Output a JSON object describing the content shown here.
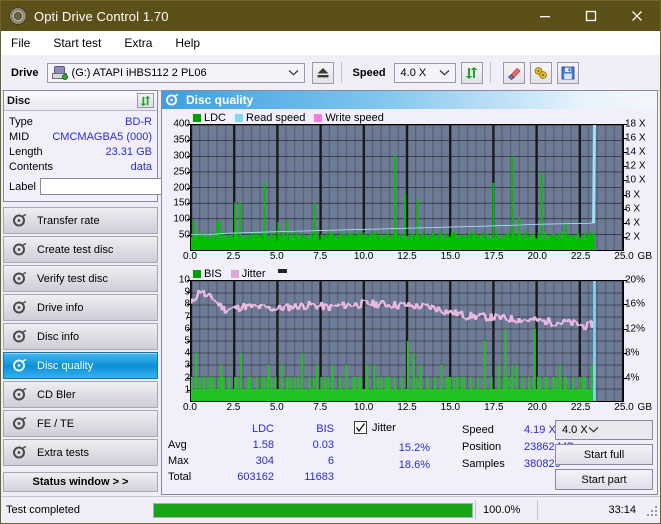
{
  "window": {
    "title": "Opti Drive Control 1.70",
    "minimize": "minimize",
    "maximize": "maximize",
    "close": "close",
    "titlebar_color": "#5b5118"
  },
  "menu": {
    "items": [
      "File",
      "Start test",
      "Extra",
      "Help"
    ]
  },
  "toolbar": {
    "drive_label": "Drive",
    "drive_value": "(G:)   ATAPI iHBS112  2 PL06",
    "eject": "eject",
    "speed_label": "Speed",
    "speed_value": "4.0 X",
    "refresh": "refresh",
    "erase": "erase",
    "tools": "tools",
    "save": "save"
  },
  "disc": {
    "title": "Disc",
    "refresh_btn": "refresh",
    "rows": [
      {
        "key": "Type",
        "value": "BD-R"
      },
      {
        "key": "MID",
        "value": "CMCMAGBA5 (000)"
      },
      {
        "key": "Length",
        "value": "23.31 GB"
      },
      {
        "key": "Contents",
        "value": "data"
      }
    ],
    "label_key": "Label",
    "label_value": "",
    "label_placeholder": ""
  },
  "nav": {
    "items": [
      {
        "label": "Transfer rate",
        "selected": false
      },
      {
        "label": "Create test disc",
        "selected": false
      },
      {
        "label": "Verify test disc",
        "selected": false
      },
      {
        "label": "Drive info",
        "selected": false
      },
      {
        "label": "Disc info",
        "selected": false
      },
      {
        "label": "Disc quality",
        "selected": true
      },
      {
        "label": "CD Bler",
        "selected": false
      },
      {
        "label": "FE / TE",
        "selected": false
      },
      {
        "label": "Extra tests",
        "selected": false
      }
    ],
    "status_window": "Status window > >"
  },
  "main": {
    "title": "Disc quality"
  },
  "stats": {
    "col_headers": [
      "LDC",
      "BIS"
    ],
    "row_headers": [
      "Avg",
      "Max",
      "Total"
    ],
    "ldc": [
      "1.58",
      "304",
      "603162"
    ],
    "bis": [
      "0.03",
      "6",
      "11683"
    ],
    "jitter_label": "Jitter",
    "jitter_checked": true,
    "jitter_avg": "15.2%",
    "jitter_max": "18.6%",
    "speed_key": "Speed",
    "speed_value": "4.19 X",
    "position_key": "Position",
    "position_value": "23862 MB",
    "samples_key": "Samples",
    "samples_value": "380829",
    "speed_select": "4.0 X",
    "start_full": "Start full",
    "start_part": "Start part"
  },
  "statusbar": {
    "message": "Test completed",
    "percent_label": "100.0%",
    "percent_value": 100,
    "elapsed": "33:14"
  },
  "colors": {
    "ldc_green": "#00b000",
    "read_speed": "#82d8f4",
    "write_speed": "#ff7adf",
    "bis_green": "#22c222",
    "jitter_pink": "#e8b8e0",
    "plot_bg": "#6e7b96",
    "progress_green": "#17a517"
  },
  "chart_data": [
    {
      "type": "line",
      "title": "LDC / Read speed",
      "xlabel": "GB",
      "ylabel": "LDC",
      "xlim": [
        0,
        25
      ],
      "ylim": [
        0,
        400
      ],
      "y2lim": [
        0,
        18
      ],
      "y2label": "X",
      "grid": true,
      "legend": [
        "LDC",
        "Read speed",
        "Write speed"
      ],
      "legend_position": "top-left",
      "xticks": [
        "0.0",
        "2.5",
        "5.0",
        "7.5",
        "10.0",
        "12.5",
        "15.0",
        "17.5",
        "20.0",
        "22.5",
        "25.0"
      ],
      "yticks": [
        50,
        100,
        150,
        200,
        250,
        300,
        350,
        400
      ],
      "y2ticks": [
        "2 X",
        "4 X",
        "6 X",
        "8 X",
        "10 X",
        "12 X",
        "14 X",
        "16 X",
        "18 X"
      ],
      "series": [
        {
          "name": "LDC",
          "kind": "impulse",
          "color": "#00b000",
          "x": [
            0.05,
            0.15,
            0.25,
            0.35,
            0.45,
            0.55,
            0.65,
            0.75,
            0.85,
            0.95,
            1.05,
            1.15,
            1.25,
            1.35,
            1.45,
            1.55,
            1.65,
            1.75,
            1.85,
            1.95,
            2.05,
            2.15,
            2.25,
            2.35,
            2.45,
            2.55,
            2.65,
            2.75,
            2.85,
            2.95,
            3.05,
            3.15,
            3.25,
            3.35,
            3.45,
            3.55,
            3.65,
            3.75,
            3.85,
            3.95,
            4.05,
            4.15,
            4.25,
            4.35,
            4.45,
            4.55,
            4.65,
            4.75,
            4.85,
            4.95,
            5.05,
            5.15,
            5.25,
            5.35,
            5.45,
            5.55,
            5.65,
            5.75,
            5.85,
            5.95,
            6.05,
            6.15,
            6.25,
            6.35,
            6.45,
            6.55,
            6.65,
            6.75,
            6.85,
            6.95,
            7.05,
            7.15,
            7.25,
            7.35,
            7.45,
            7.55,
            7.65,
            7.75,
            7.85,
            7.95,
            8.05,
            8.15,
            8.25,
            8.35,
            8.45,
            8.55,
            8.65,
            8.75,
            8.85,
            8.95,
            9.05,
            9.15,
            9.25,
            9.35,
            9.45,
            9.55,
            9.65,
            9.75,
            9.85,
            9.95,
            10.1,
            10.2,
            10.3,
            10.4,
            10.5,
            10.6,
            10.7,
            10.8,
            10.9,
            11.0,
            11.1,
            11.2,
            11.3,
            11.4,
            11.5,
            11.6,
            11.7,
            11.8,
            11.9,
            12.0,
            12.1,
            12.2,
            12.3,
            12.4,
            12.5,
            12.6,
            12.7,
            12.8,
            12.9,
            13.0,
            13.1,
            13.2,
            13.3,
            13.4,
            13.5,
            13.6,
            13.7,
            13.8,
            13.9,
            14.0,
            14.1,
            14.2,
            14.3,
            14.4,
            14.5,
            14.6,
            14.7,
            14.8,
            14.9,
            15.0,
            15.1,
            15.2,
            15.3,
            15.4,
            15.5,
            15.6,
            15.7,
            15.8,
            15.9,
            16.0,
            16.1,
            16.2,
            16.3,
            16.4,
            16.5,
            16.6,
            16.7,
            16.8,
            16.9,
            17.0,
            17.1,
            17.2,
            17.3,
            17.4,
            17.5,
            17.6,
            17.7,
            17.8,
            17.9,
            18.0,
            18.1,
            18.2,
            18.3,
            18.4,
            18.5,
            18.6,
            18.7,
            18.8,
            18.9,
            19.0,
            19.1,
            19.2,
            19.3,
            19.4,
            19.5,
            19.6,
            19.7,
            19.8,
            19.9,
            20.0,
            20.1,
            20.2,
            20.3,
            20.4,
            20.5,
            20.6,
            20.7,
            20.8,
            20.9,
            21.0,
            21.1,
            21.2,
            21.3,
            21.4,
            21.5,
            21.6,
            21.7,
            21.8,
            21.9,
            22.0,
            22.1,
            22.2,
            22.3,
            22.4,
            22.5,
            22.6,
            22.7,
            22.8,
            22.9,
            23.0,
            23.1,
            23.2,
            23.3
          ],
          "y": [
            42,
            95,
            40,
            55,
            35,
            60,
            30,
            45,
            38,
            50,
            42,
            35,
            48,
            30,
            55,
            88,
            95,
            40,
            62,
            35,
            50,
            38,
            45,
            30,
            42,
            152,
            60,
            38,
            152,
            45,
            35,
            50,
            42,
            30,
            38,
            55,
            45,
            60,
            35,
            50,
            40,
            30,
            215,
            55,
            42,
            35,
            60,
            38,
            48,
            30,
            90,
            45,
            35,
            52,
            40,
            95,
            30,
            42,
            55,
            38,
            45,
            60,
            35,
            50,
            40,
            30,
            48,
            42,
            35,
            55,
            38,
            152,
            60,
            42,
            30,
            50,
            35,
            45,
            40,
            38,
            62,
            55,
            35,
            48,
            42,
            30,
            60,
            38,
            50,
            35,
            45,
            40,
            55,
            30,
            42,
            48,
            35,
            60,
            38,
            50,
            45,
            35,
            42,
            55,
            30,
            60,
            38,
            48,
            35,
            50,
            42,
            40,
            30,
            55,
            38,
            45,
            35,
            305,
            60,
            42,
            30,
            50,
            38,
            180,
            45,
            35,
            40,
            55,
            30,
            48,
            165,
            42,
            35,
            60,
            38,
            50,
            45,
            30,
            42,
            55,
            40,
            35,
            48,
            60,
            38,
            30,
            50,
            45,
            35,
            42,
            55,
            38,
            60,
            30,
            48,
            40,
            35,
            50,
            42,
            38,
            55,
            30,
            45,
            60,
            35,
            42,
            48,
            38,
            50,
            30,
            55,
            40,
            35,
            45,
            215,
            38,
            60,
            42,
            30,
            50,
            35,
            48,
            55,
            40,
            38,
            300,
            62,
            30,
            45,
            105,
            50,
            35,
            42,
            60,
            38,
            48,
            30,
            55,
            40,
            35,
            50,
            42,
            245,
            38,
            60,
            30,
            45,
            48,
            35,
            52,
            40,
            38,
            55,
            30,
            60,
            42,
            90,
            35,
            50,
            45,
            38,
            48,
            30,
            55,
            40,
            35,
            42,
            60,
            38,
            50,
            45,
            30,
            55
          ]
        },
        {
          "name": "Read speed",
          "kind": "line",
          "color": "#82d8f4",
          "x": [
            0.0,
            1.0,
            2.0,
            3.2,
            4.5,
            6.0,
            7.5,
            9.0,
            10.5,
            12.0,
            13.5,
            15.0,
            16.5,
            17.8,
            19.0,
            20.0,
            21.0,
            22.0,
            23.0,
            23.3,
            23.35
          ],
          "y_speed_x": [
            2.2,
            2.2,
            2.4,
            2.5,
            2.6,
            2.7,
            2.8,
            2.9,
            3.0,
            3.1,
            3.2,
            3.3,
            3.4,
            3.5,
            3.6,
            3.7,
            3.75,
            3.8,
            3.85,
            3.9,
            18.0
          ]
        },
        {
          "name": "Write speed",
          "kind": "line",
          "color": "#ff7adf",
          "x": [],
          "y": []
        }
      ]
    },
    {
      "type": "line",
      "title": "BIS / Jitter",
      "xlabel": "GB",
      "ylabel": "BIS",
      "xlim": [
        0,
        25
      ],
      "ylim": [
        0,
        10
      ],
      "y2lim": [
        0,
        20
      ],
      "y2label": "%",
      "grid": true,
      "legend": [
        "BIS",
        "Jitter"
      ],
      "legend_position": "top-left",
      "xticks": [
        "0.0",
        "2.5",
        "5.0",
        "7.5",
        "10.0",
        "12.5",
        "15.0",
        "17.5",
        "20.0",
        "22.5",
        "25.0"
      ],
      "yticks": [
        1,
        2,
        3,
        4,
        5,
        6,
        7,
        8,
        9,
        10
      ],
      "y2ticks": [
        "4%",
        "8%",
        "12%",
        "16%",
        "20%"
      ],
      "series": [
        {
          "name": "BIS",
          "kind": "impulse",
          "color": "#22c222",
          "baseline": 1,
          "spikes_x": [
            0.3,
            0.5,
            0.75,
            1.0,
            1.3,
            1.75,
            1.9,
            2.2,
            2.55,
            2.9,
            3.3,
            3.45,
            3.8,
            4.1,
            4.5,
            4.9,
            5.25,
            5.6,
            6.0,
            6.45,
            6.9,
            7.3,
            7.8,
            8.2,
            8.6,
            9.0,
            9.4,
            9.8,
            10.2,
            10.6,
            11.0,
            11.4,
            11.8,
            12.2,
            12.55,
            12.9,
            13.3,
            13.7,
            14.1,
            14.5,
            14.9,
            15.4,
            15.8,
            16.2,
            16.6,
            17.0,
            17.4,
            17.8,
            18.2,
            18.6,
            18.85,
            19.2,
            19.55,
            19.9,
            20.2,
            20.6,
            21.0,
            21.35,
            21.7,
            22.1,
            22.5,
            22.8,
            23.2
          ],
          "spikes_y": [
            4,
            2,
            2,
            2,
            2,
            3,
            2,
            2,
            2,
            4,
            2,
            2,
            2,
            2,
            3,
            2,
            3,
            2,
            2,
            4,
            2,
            3,
            2,
            3,
            2,
            3,
            2,
            2,
            3,
            3,
            2,
            2,
            2,
            2,
            5,
            4,
            3,
            2,
            2,
            3,
            2,
            2,
            2,
            2,
            2,
            5,
            2,
            3,
            6,
            3,
            3,
            2,
            2,
            6,
            2,
            2,
            2,
            3,
            2,
            2,
            2,
            2,
            3
          ]
        },
        {
          "name": "Jitter",
          "kind": "line",
          "color": "#e8b8e0",
          "x": [
            0.0,
            0.3,
            0.6,
            0.9,
            1.2,
            1.5,
            2.0,
            2.5,
            3.0,
            4.0,
            5.0,
            6.0,
            7.0,
            8.0,
            9.0,
            10.0,
            11.0,
            12.0,
            13.0,
            14.0,
            15.0,
            16.0,
            17.0,
            18.0,
            19.0,
            20.0,
            21.0,
            22.0,
            23.0,
            23.3
          ],
          "y_pct": [
            16.0,
            17.6,
            18.6,
            17.2,
            17.4,
            16.4,
            15.2,
            15.4,
            15.8,
            15.6,
            15.4,
            15.8,
            16.0,
            15.6,
            16.0,
            16.2,
            16.2,
            16.0,
            15.8,
            15.6,
            14.8,
            14.2,
            14.0,
            13.8,
            13.6,
            13.4,
            13.2,
            13.0,
            12.4,
            13.0
          ]
        }
      ]
    }
  ]
}
